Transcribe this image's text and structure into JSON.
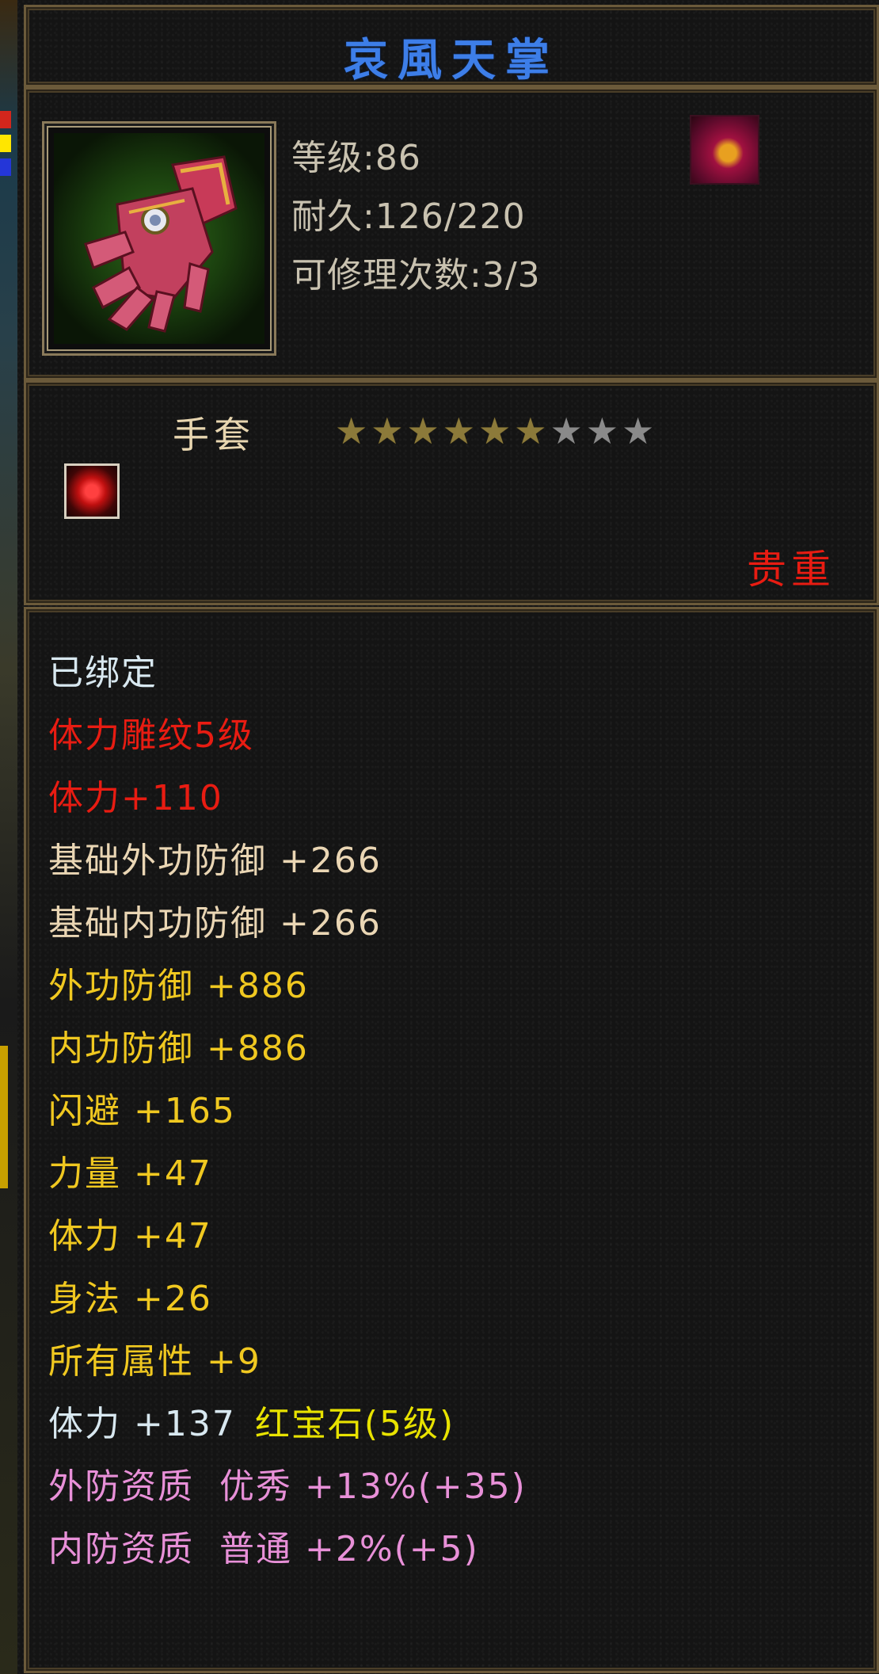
{
  "title": "哀風天掌",
  "info": {
    "level": "等级:86",
    "durability": "耐久:126/220",
    "repair": "可修理次数:3/3",
    "item_icon": "gauntlet-icon",
    "skill_icon": "flame-skill-icon"
  },
  "type": {
    "label": "手套",
    "stars_total": 9,
    "stars_filled": 6,
    "gem_socket_icon": "ruby-socket-icon",
    "rarity": "贵重"
  },
  "attributes": [
    {
      "text": "已绑定",
      "color": "white"
    },
    {
      "text": "体力雕纹5级",
      "color": "red"
    },
    {
      "text": "体力+110",
      "color": "red"
    },
    {
      "text": "基础外功防御 +266",
      "color": "tan"
    },
    {
      "text": "基础内功防御 +266",
      "color": "tan"
    },
    {
      "text": "外功防御 +886",
      "color": "yellow"
    },
    {
      "text": "内功防御 +886",
      "color": "yellow"
    },
    {
      "text": "闪避 +165",
      "color": "yellow"
    },
    {
      "text": "力量 +47",
      "color": "yellow"
    },
    {
      "text": "体力 +47",
      "color": "yellow"
    },
    {
      "text": "身法 +26",
      "color": "yellow"
    },
    {
      "text": "所有属性 +9",
      "color": "yellow"
    },
    {
      "text": "体力 +137",
      "color": "white",
      "gem": "红宝石(5级)"
    },
    {
      "text": "外防资质  优秀 +13%(+35)",
      "color": "pink"
    },
    {
      "text": "内防资质  普通 +2%(+5)",
      "color": "pink"
    }
  ],
  "colors": {
    "title": "#3d7ee8",
    "rarity": "#e81c12",
    "frame": "#6b5a3a"
  }
}
